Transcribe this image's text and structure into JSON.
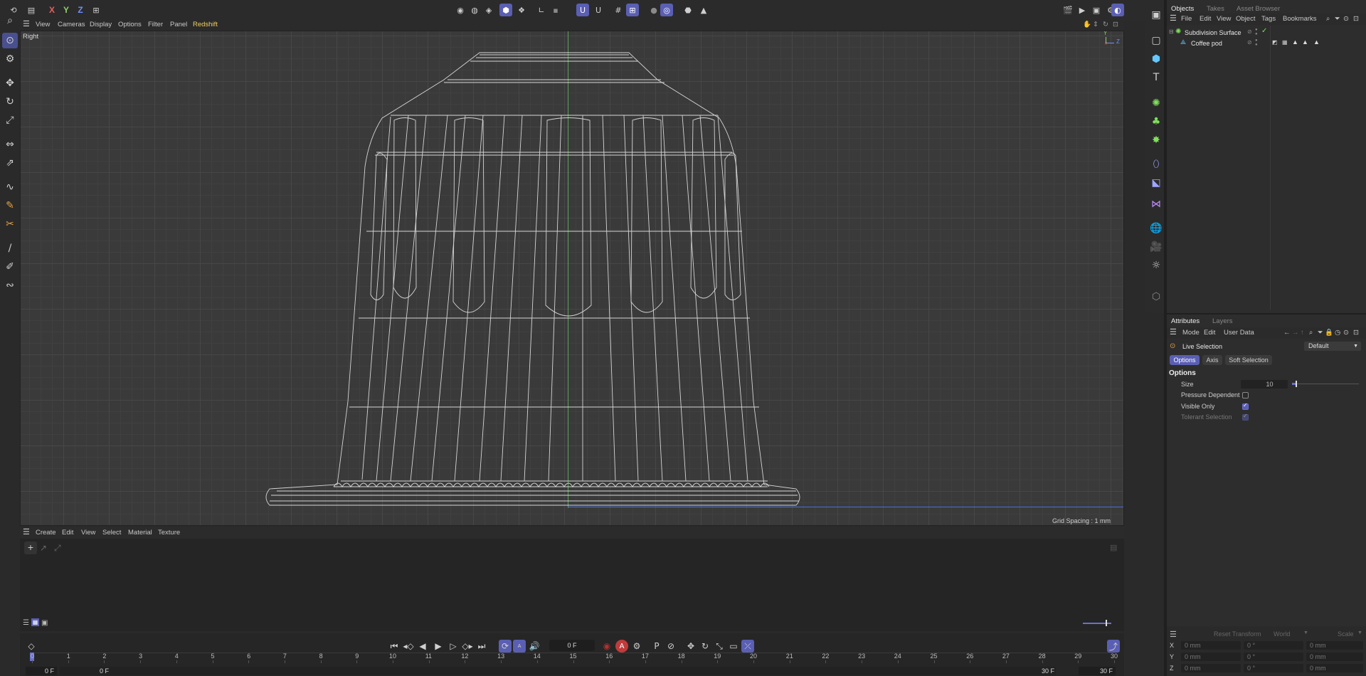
{
  "topbar": {
    "axes": [
      "X",
      "Y",
      "Z"
    ],
    "axis_colors": {
      "x": "#e06060",
      "y": "#8fd06a",
      "z": "#6f8fff"
    },
    "icons": [
      "undo-icon",
      "lock-x-icon",
      "lock-y-icon",
      "lock-z-icon",
      "coord-system-icon",
      "render-region-icon",
      "render-view-icon",
      "render-settings-icon"
    ]
  },
  "viewport": {
    "menu": [
      "View",
      "Cameras",
      "Display",
      "Options",
      "Filter",
      "Panel",
      "Redshift"
    ],
    "highlight_menu_color": "#f0d060",
    "camera_label": "Right",
    "grid_spacing": "Grid Spacing : 1 mm",
    "axis_labels": {
      "y": "Y",
      "z": "Z"
    }
  },
  "material": {
    "menu": [
      "Create",
      "Edit",
      "View",
      "Select",
      "Material",
      "Texture"
    ]
  },
  "timeline": {
    "current_frame": "0 F",
    "start_frame": "0 F",
    "min_frame": "0 F",
    "end_frame": "30 F",
    "max_frame": "30 F",
    "ticks": [
      "0",
      "1",
      "2",
      "3",
      "4",
      "5",
      "6",
      "7",
      "8",
      "9",
      "10",
      "11",
      "12",
      "13",
      "14",
      "15",
      "16",
      "17",
      "18",
      "19",
      "20",
      "21",
      "22",
      "23",
      "24",
      "25",
      "26",
      "27",
      "28",
      "29",
      "30"
    ]
  },
  "objects": {
    "tabs": [
      "Objects",
      "Takes",
      "Asset Browser"
    ],
    "menu": [
      "File",
      "Edit",
      "View",
      "Object",
      "Tags",
      "Bookmarks"
    ],
    "items": [
      {
        "name": "Subdivision Surface"
      },
      {
        "name": "Coffee pod"
      }
    ]
  },
  "attributes": {
    "tabs": [
      "Attributes",
      "Layers"
    ],
    "menu": [
      "Mode",
      "Edit",
      "User Data"
    ],
    "tool_name": "Live Selection",
    "preset": "Default",
    "subtabs": [
      "Options",
      "Axis",
      "Soft Selection"
    ],
    "section": "Options",
    "size_label": "Size",
    "size_value": "10",
    "pressure_label": "Pressure Dependent",
    "pressure_checked": false,
    "visible_label": "Visible Only",
    "visible_checked": true,
    "tolerant_label": "Tolerant Selection",
    "tolerant_checked": true
  },
  "coordinates": {
    "reset": "Reset Transform",
    "space": "World",
    "mode": "Scale",
    "rows": [
      {
        "axis": "X",
        "pos": "0 mm",
        "rot": "0 °",
        "scale": "0 mm"
      },
      {
        "axis": "Y",
        "pos": "0 mm",
        "rot": "0 °",
        "scale": "0 mm"
      },
      {
        "axis": "Z",
        "pos": "0 mm",
        "rot": "0 °",
        "scale": "0 mm"
      }
    ]
  }
}
